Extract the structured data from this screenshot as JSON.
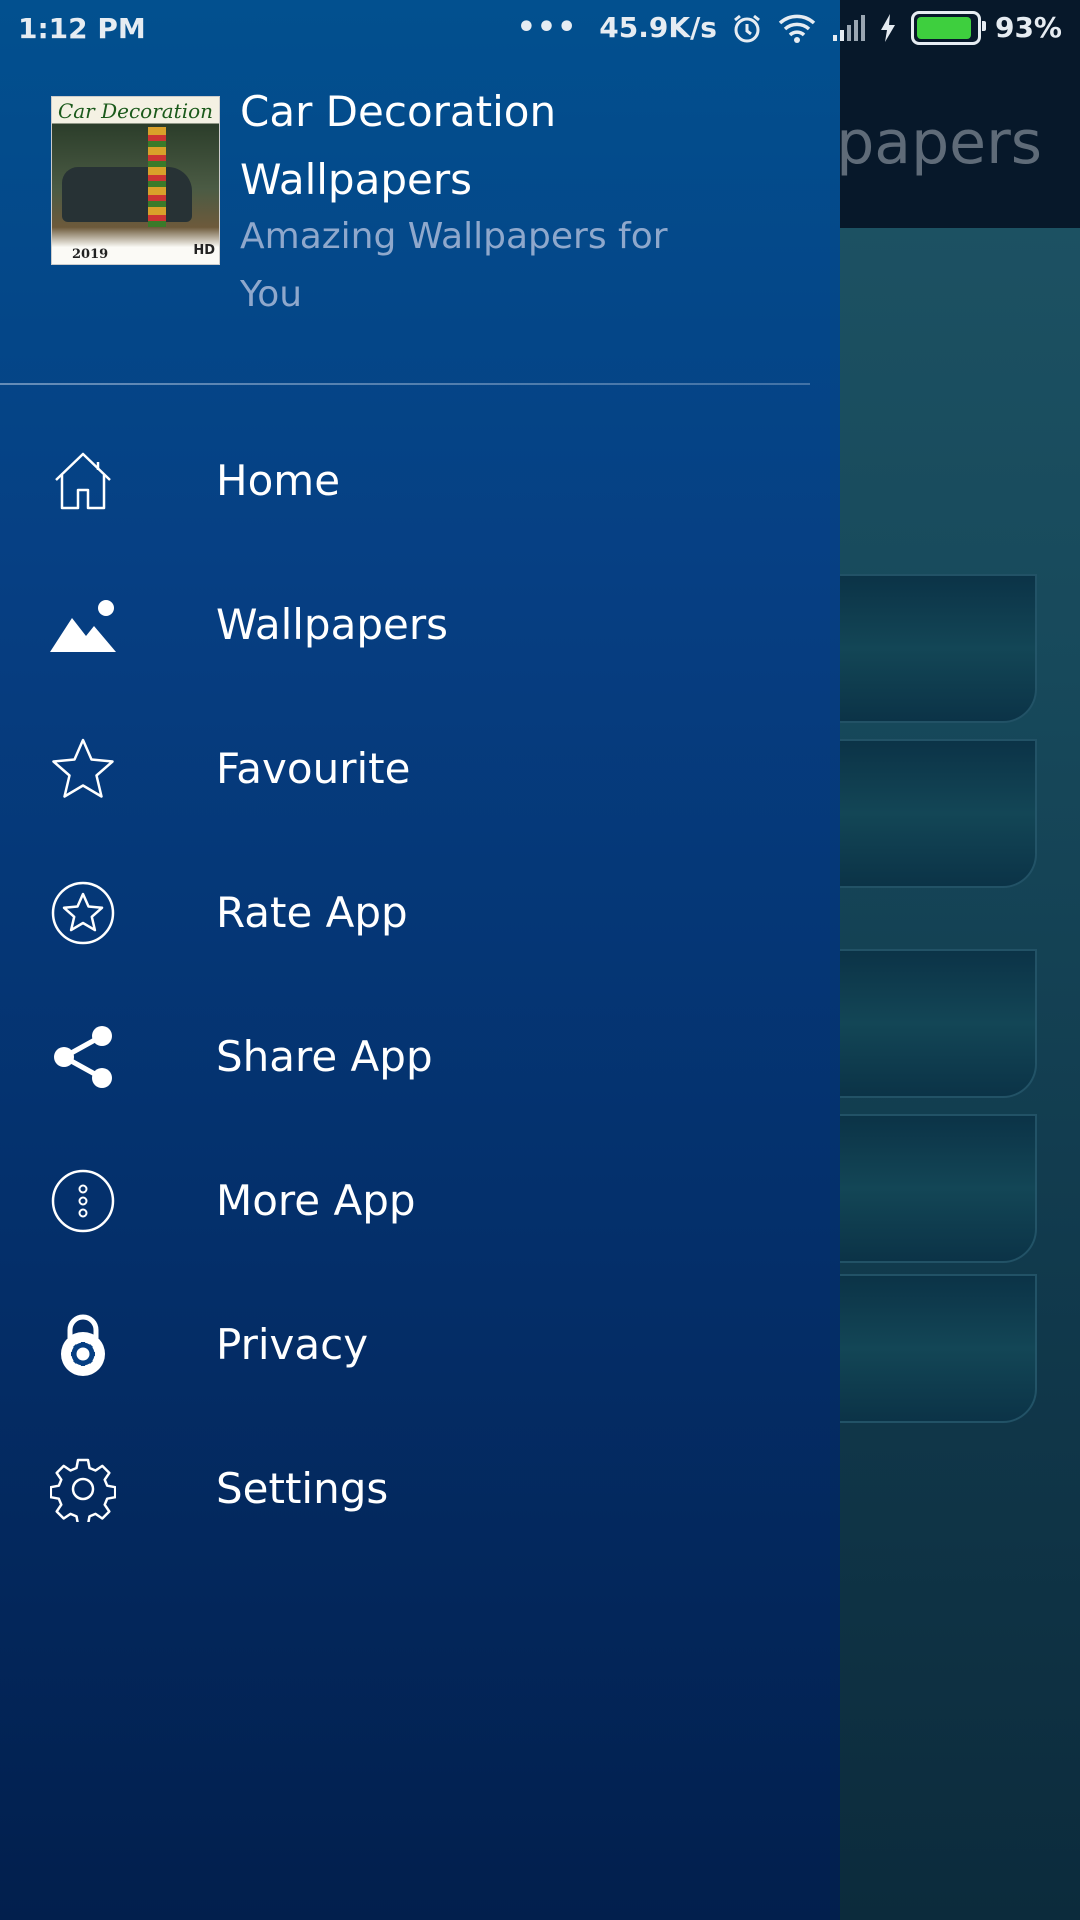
{
  "status_bar": {
    "time": "1:12 PM",
    "dots": "•••",
    "network_speed": "45.9K/s",
    "battery_percent": "93%",
    "battery_level": 0.93,
    "icons": [
      "alarm-icon",
      "wifi-icon",
      "signal-icon",
      "charging-icon",
      "battery-icon"
    ]
  },
  "background": {
    "title_fragment": "papers"
  },
  "drawer": {
    "app_title": "Car Decoration Wallpapers",
    "app_subtitle": "Amazing Wallpapers for You",
    "logo": {
      "text_top": "Car Decoration",
      "year": "2019",
      "badge": "HD"
    },
    "items": [
      {
        "label": "Home",
        "icon": "home-icon"
      },
      {
        "label": "Wallpapers",
        "icon": "image-icon"
      },
      {
        "label": "Favourite",
        "icon": "star-icon"
      },
      {
        "label": "Rate App",
        "icon": "rate-star-circle-icon"
      },
      {
        "label": "Share App",
        "icon": "share-icon"
      },
      {
        "label": "More App",
        "icon": "more-vertical-circle-icon"
      },
      {
        "label": "Privacy",
        "icon": "lock-gear-icon"
      },
      {
        "label": "Settings",
        "icon": "gear-icon"
      }
    ]
  },
  "colors": {
    "drawer_top": "#02508f",
    "drawer_bottom": "#021f4d",
    "subtitle": "#8fa8cc",
    "battery_fill": "#3ecf3e"
  }
}
